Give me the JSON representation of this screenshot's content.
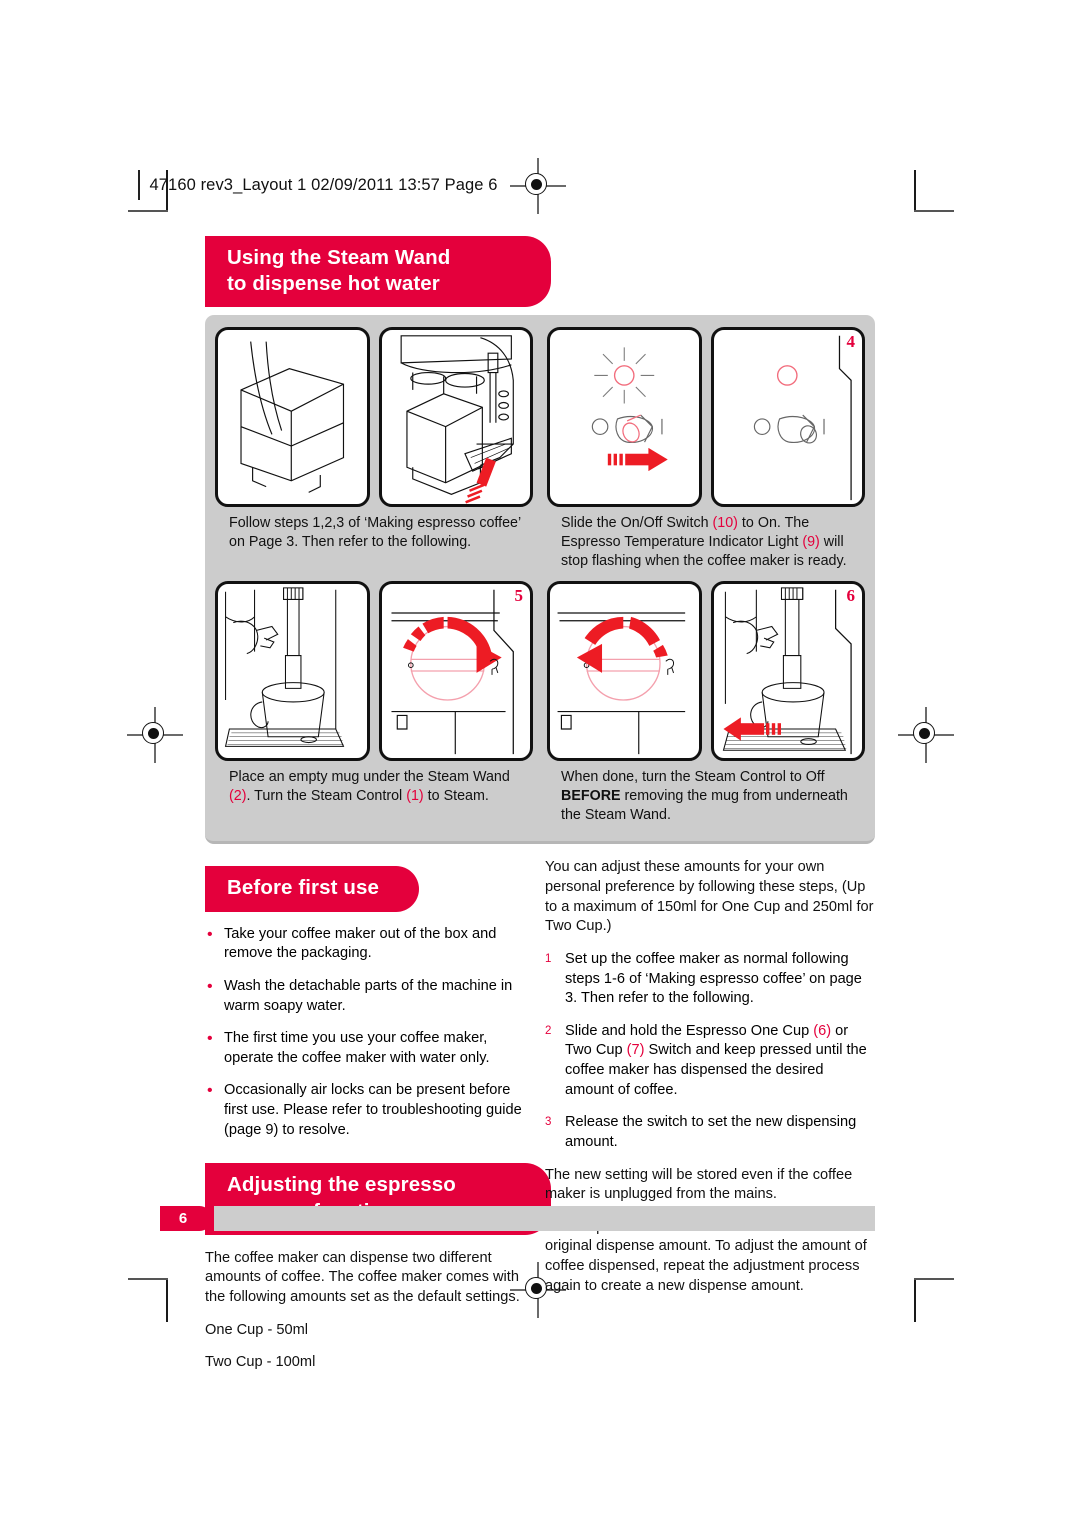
{
  "document": {
    "header_line": "47160 rev3_Layout 1  02/09/2011  13:57  Page 6",
    "page_number": "6"
  },
  "sections": {
    "steam_wand": {
      "title_line1": "Using the Steam Wand",
      "title_line2": "to dispense hot water",
      "panels": [
        {
          "number": "",
          "name": "water-tank-fill"
        },
        {
          "number": "",
          "name": "water-tank-insert"
        },
        {
          "number": "",
          "name": "on-off-switch-on"
        },
        {
          "number": "4",
          "name": "indicator-light-steady"
        },
        {
          "number": "",
          "name": "mug-under-steam-wand"
        },
        {
          "number": "5",
          "name": "steam-control-to-steam"
        },
        {
          "number": "",
          "name": "steam-control-to-off"
        },
        {
          "number": "6",
          "name": "remove-mug"
        }
      ],
      "caption_1": {
        "pre": "Follow steps 1,2,3 of ‘Making espresso coffee’ on Page 3. Then refer to the following."
      },
      "caption_2": {
        "p1": "Slide the On/Off Switch ",
        "ref1": "(10)",
        "p2": " to On. The Espresso Temperature Indicator Light ",
        "ref2": "(9)",
        "p3": " will stop flashing when the coffee maker is ready."
      },
      "caption_3": {
        "p1": "Place an empty mug under the Steam Wand ",
        "ref1": "(2)",
        "p2": ". Turn the Steam Control ",
        "ref2": "(1)",
        "p3": " to Steam."
      },
      "caption_4": {
        "p1": "When done, turn the Steam Control to Off ",
        "bold": "BEFORE",
        "p2": " removing the mug from underneath the Steam Wand."
      }
    },
    "before_first_use": {
      "title": "Before first use",
      "bullets": [
        "Take your coffee maker out of the box and remove the packaging.",
        "Wash the detachable parts of the machine in warm soapy water.",
        "The first time you use your coffee maker, operate the coffee maker with water only.",
        "Occasionally air locks can be present before first use. Please refer to troubleshooting guide (page 9) to resolve."
      ]
    },
    "memory_function": {
      "title_line1": "Adjusting the espresso",
      "title_line2": "memory function",
      "intro": "The coffee maker can dispense two different amounts of coffee. The coffee maker comes with the following amounts set as the default settings.",
      "default_one_cup": "One Cup - 50ml",
      "default_two_cup": "Two Cup - 100ml",
      "right_intro": "You can adjust these amounts for your own personal preference by following these steps, (Up to a maximum of 150ml for One Cup and 250ml for Two Cup.)",
      "steps": [
        {
          "num": "1",
          "text": "Set up the coffee maker as normal following steps 1-6 of ‘Making espresso coffee’ on page 3. Then refer to the following."
        },
        {
          "num": "2",
          "pre": "Slide and hold the Espresso One Cup ",
          "ref1": "(6)",
          "mid": " or Two Cup ",
          "ref2": "(7)",
          "post": " Switch and keep pressed until the coffee maker has dispensed the desired amount of coffee."
        },
        {
          "num": "3",
          "text": "Release the switch to set the new dispensing amount."
        }
      ],
      "note_1": "The new setting will be stored even if the coffee maker is unplugged from the mains.",
      "note_2": "It is not possible to reset the amount back to the original dispense amount.  To adjust the amount of coffee dispensed, repeat the adjustment process again to create a new dispense amount."
    }
  },
  "colors": {
    "brand_red": "#e4003c",
    "board_grey": "#cccccc",
    "footer_grey": "#cdcdcd"
  }
}
